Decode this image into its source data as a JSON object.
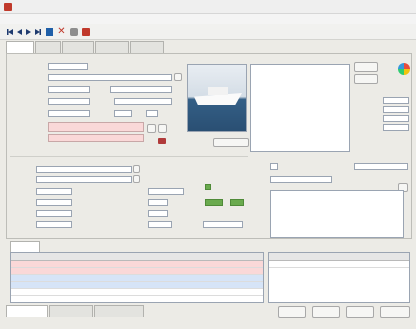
{
  "window": {
    "title": ""
  },
  "menu": [
    {
      "label": ""
    },
    {
      "label": ""
    }
  ],
  "tabs": [
    {
      "label": ""
    },
    {
      "label": ""
    },
    {
      "label": ""
    },
    {
      "label": ""
    },
    {
      "label": ""
    }
  ],
  "photo_buttons": [
    {
      "label": ""
    },
    {
      "label": ""
    }
  ],
  "image_button": {
    "label": ""
  },
  "engine_tabs": [
    {
      "label": ""
    }
  ],
  "footer_tabs": [
    {
      "label": ""
    },
    {
      "label": ""
    },
    {
      "label": ""
    }
  ],
  "footer_buttons": [
    {
      "label": ""
    },
    {
      "label": ""
    },
    {
      "label": ""
    },
    {
      "label": ""
    }
  ],
  "colors": {
    "row_highlight": "#fad8d8",
    "row_selected": "#d6e4f7",
    "accent_green": "#6aaa4e",
    "title_red": "#c0392b"
  }
}
